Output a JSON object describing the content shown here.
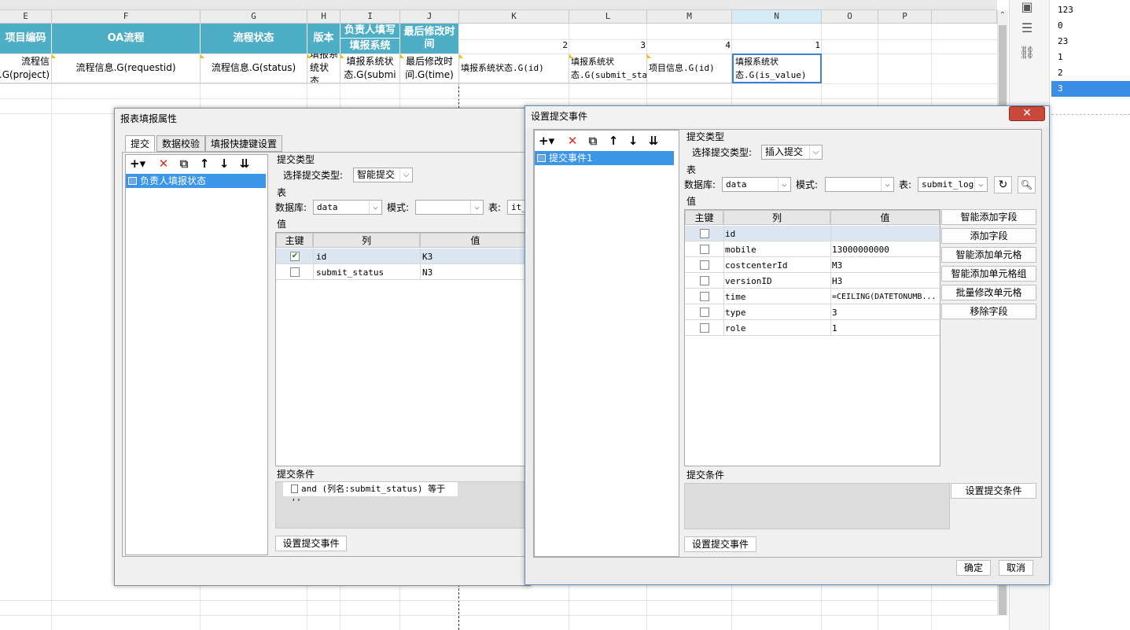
{
  "sheet": {
    "columns": [
      "E",
      "F",
      "G",
      "H",
      "I",
      "J",
      "K",
      "L",
      "M",
      "N",
      "O",
      "P"
    ],
    "selected_column": "N",
    "headers": {
      "E": "项目编码",
      "F": "OA流程",
      "G": "流程状态",
      "H": "版本",
      "I_top": "负责人填写",
      "I_bottom": "填报系统",
      "J": "最后修改时间"
    },
    "numbers": {
      "K": "2",
      "L": "3",
      "M": "4",
      "N": "1"
    },
    "cells": {
      "E": "流程信息.G(project)",
      "F": "流程信息.G(requestid)",
      "G": "流程信息.G(status)",
      "H": "填报系统状态.",
      "I": "填报系统状态.G(submi",
      "J": "最后修改时间.G(time)",
      "K": "填报系统状态.G(id)",
      "L": "填报系统状态.G(submit_status)",
      "M": "项目信息.G(id)",
      "N": "填报系统状态.G(is_value)"
    }
  },
  "side_list": [
    "123",
    "0",
    "23",
    "1",
    "2",
    "3"
  ],
  "side_list_selected": "3",
  "dialog_attr": {
    "title": "报表填报属性",
    "tabs": [
      "提交",
      "数据校验",
      "填报快捷键设置"
    ],
    "tree_item": "负责人填报状态",
    "submit_type_section": "提交类型",
    "submit_type_label": "选择提交类型:",
    "submit_type_value": "智能提交",
    "table_section": "表",
    "db_label": "数据库:",
    "db_value": "data",
    "schema_label": "模式:",
    "table_label": "表:",
    "table_value": "it_",
    "value_section": "值",
    "col_key": "主键",
    "col_col": "列",
    "col_val": "值",
    "rows": [
      {
        "checked": true,
        "col": "id",
        "val": "K3"
      },
      {
        "checked": false,
        "col": "submit_status",
        "val": "N3"
      }
    ],
    "cond_section": "提交条件",
    "cond_text": "and (列名:submit_status) 等于 ''",
    "event_button": "设置提交事件"
  },
  "dialog_event": {
    "title": "设置提交事件",
    "close": "✕",
    "tree_item": "提交事件1",
    "submit_type_section": "提交类型",
    "submit_type_label": "选择提交类型:",
    "submit_type_value": "插入提交",
    "table_section": "表",
    "db_label": "数据库:",
    "db_value": "data",
    "schema_label": "模式:",
    "table_label": "表:",
    "table_value": "submit_log",
    "value_section": "值",
    "col_key": "主键",
    "col_col": "列",
    "col_val": "值",
    "rows": [
      {
        "col": "id",
        "val": ""
      },
      {
        "col": "mobile",
        "val": "13000000000"
      },
      {
        "col": "costcenterId",
        "val": "M3"
      },
      {
        "col": "versionID",
        "val": "H3"
      },
      {
        "col": "time",
        "val": "=CEILING(DATETONUMB..."
      },
      {
        "col": "type",
        "val": "3"
      },
      {
        "col": "role",
        "val": "1"
      }
    ],
    "side_buttons": [
      "智能添加字段",
      "添加字段",
      "智能添加单元格",
      "智能添加单元格组",
      "批量修改单元格",
      "移除字段"
    ],
    "cond_section": "提交条件",
    "cond_button": "设置提交条件",
    "event_button": "设置提交事件",
    "ok": "确定",
    "cancel": "取消"
  }
}
